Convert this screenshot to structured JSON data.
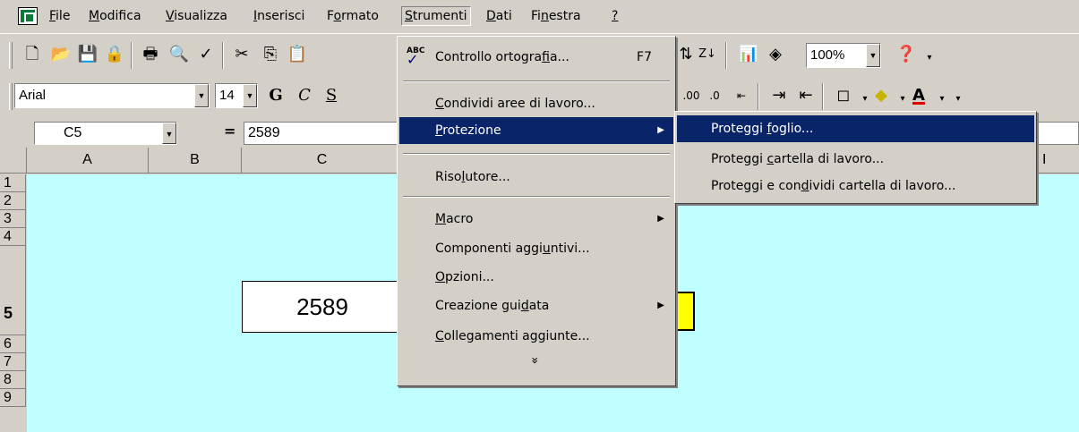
{
  "menubar": {
    "items": [
      {
        "pre": "",
        "key": "F",
        "post": "ile"
      },
      {
        "pre": "",
        "key": "M",
        "post": "odifica"
      },
      {
        "pre": "",
        "key": "V",
        "post": "isualizza"
      },
      {
        "pre": "",
        "key": "I",
        "post": "nserisci"
      },
      {
        "pre": "F",
        "key": "o",
        "post": "rmato"
      },
      {
        "pre": "",
        "key": "S",
        "post": "trumenti"
      },
      {
        "pre": "",
        "key": "D",
        "post": "ati"
      },
      {
        "pre": "Fi",
        "key": "n",
        "post": "estra"
      },
      {
        "pre": "",
        "key": "?",
        "post": ""
      }
    ]
  },
  "toolbar": {
    "zoom": "100%",
    "font_name": "Arial",
    "font_size": "14",
    "bold_label": "G",
    "italic_label": "C",
    "underline_label": "S"
  },
  "formula_bar": {
    "cell_ref": "C5",
    "equals": "=",
    "value": "2589"
  },
  "columns": [
    "A",
    "B",
    "C",
    "I"
  ],
  "rows": [
    "1",
    "2",
    "3",
    "4",
    "5",
    "6",
    "7",
    "8",
    "9"
  ],
  "cell_c5": "2589",
  "tools_menu": {
    "spelling": {
      "pre": "Controllo ortogra",
      "key": "f",
      "post": "ia...",
      "shortcut": "F7"
    },
    "share": {
      "pre": "",
      "key": "C",
      "post": "ondividi aree di lavoro..."
    },
    "protection": {
      "pre": "",
      "key": "P",
      "post": "rotezione"
    },
    "solver": {
      "pre": "Riso",
      "key": "l",
      "post": "utore..."
    },
    "macro": {
      "pre": "",
      "key": "M",
      "post": "acro"
    },
    "addins": {
      "pre": "Componenti aggi",
      "key": "u",
      "post": "ntivi..."
    },
    "options": {
      "pre": "",
      "key": "O",
      "post": "pzioni..."
    },
    "wizard": {
      "pre": "Creazione gui",
      "key": "d",
      "post": "ata"
    },
    "links": {
      "pre": "",
      "key": "C",
      "post": "ollegamenti aggiunte..."
    },
    "more": "»"
  },
  "protection_submenu": {
    "sheet": {
      "pre": "Proteggi ",
      "key": "f",
      "post": "oglio..."
    },
    "workbook": {
      "pre": "Proteggi ",
      "key": "c",
      "post": "artella di lavoro..."
    },
    "shared": {
      "pre": "Proteggi e con",
      "key": "d",
      "post": "ividi cartella di lavoro..."
    }
  },
  "colors": {
    "menu_bg": "#d4d0c8",
    "highlight": "#0a246a",
    "sheet_bg": "#c0ffff",
    "yellow": "#ffff00"
  }
}
